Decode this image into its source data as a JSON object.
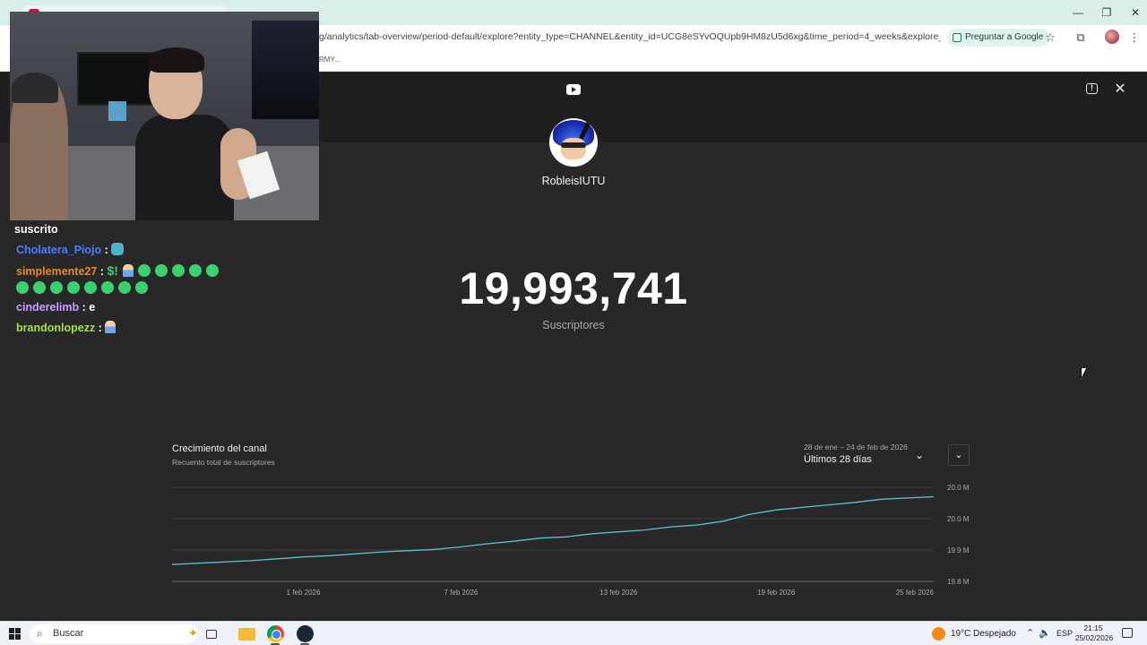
{
  "browser": {
    "url": "g/analytics/tab-overview/period-default/explore?entity_type=CHANNEL&entity_id=UCG8eSYvOQUpb9HM8zU5d6xg&time_period=4_weeks&explore_type=SUBSCRIB...",
    "ask_google_label": "Preguntar a Google",
    "bookmark_label": "RMY..."
  },
  "channel": {
    "name": "RobleisIUTU",
    "subscriber_count": "19,993,741",
    "subscriber_label": "Suscriptores"
  },
  "chart_card": {
    "title": "Crecimiento del canal",
    "subtitle": "Recuento total de suscriptores",
    "date_range": "28 de ene – 24 de feb de 2026",
    "period_label": "Últimos 28 días"
  },
  "chart_data": {
    "type": "line",
    "x": [
      "27 ene 2026",
      "28 ene 2026",
      "29 ene 2026",
      "30 ene 2026",
      "31 ene 2026",
      "1 feb 2026",
      "2 feb 2026",
      "3 feb 2026",
      "4 feb 2026",
      "5 feb 2026",
      "6 feb 2026",
      "7 feb 2026",
      "8 feb 2026",
      "9 feb 2026",
      "10 feb 2026",
      "11 feb 2026",
      "12 feb 2026",
      "13 feb 2026",
      "14 feb 2026",
      "15 feb 2026",
      "16 feb 2026",
      "17 feb 2026",
      "18 feb 2026",
      "19 feb 2026",
      "20 feb 2026",
      "21 feb 2026",
      "22 feb 2026",
      "23 feb 2026",
      "24 feb 2026",
      "25 feb 2026"
    ],
    "series": [
      {
        "values": [
          19.827,
          19.829,
          19.831,
          19.833,
          19.836,
          19.839,
          19.841,
          19.844,
          19.847,
          19.849,
          19.851,
          19.855,
          19.86,
          19.864,
          19.869,
          19.871,
          19.876,
          19.879,
          19.882,
          19.887,
          19.89,
          19.896,
          19.907,
          19.914,
          19.918,
          19.922,
          19.926,
          19.931,
          19.933,
          19.935
        ],
        "color": "#5ec1cf"
      }
    ],
    "xticks": [
      "1 feb 2026",
      "7 feb 2026",
      "13 feb 2026",
      "19 feb 2026",
      "25 feb 2026"
    ],
    "yticks": [
      "19.8 M",
      "19.9 M",
      "20.0 M",
      "20.0 M"
    ],
    "ylim": [
      19.8,
      19.95
    ],
    "grid": true,
    "xlabel": "",
    "ylabel": ""
  },
  "stream_chat": {
    "header": "suscrito",
    "messages": [
      {
        "user": "Cholatera_Piojo",
        "color": "#4a7fff",
        "text": ""
      },
      {
        "user": "simplemente27",
        "color": "#e38b2c",
        "text": ""
      },
      {
        "user": "cinderelimb",
        "color": "#c7a0ff",
        "text": "e"
      },
      {
        "user": "brandonlopezz",
        "color": "#a6e33a",
        "text": ""
      }
    ],
    "separator": " : "
  },
  "taskbar": {
    "search_placeholder": "Buscar",
    "weather_temp": "19°C",
    "weather_desc": "Despejado",
    "lang": "ESP",
    "time": "21:15",
    "date": "25/02/2026"
  },
  "colors": {
    "page_bg": "#282828",
    "header_bg": "#1f1f1f",
    "line": "#5ec1cf"
  }
}
